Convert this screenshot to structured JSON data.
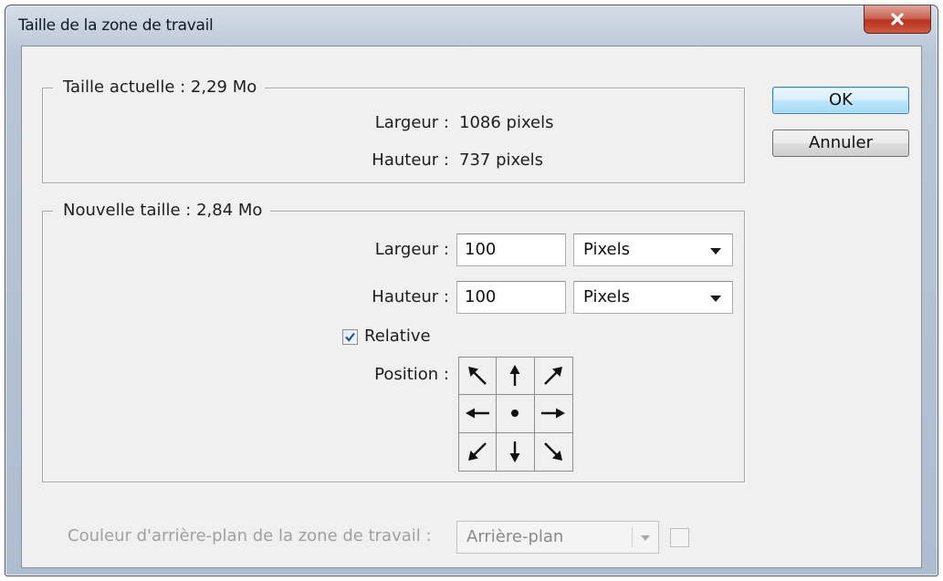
{
  "window": {
    "title": "Taille de la zone de travail"
  },
  "current_size": {
    "legend": "Taille actuelle : 2,29 Mo",
    "width_label": "Largeur :",
    "width_value": "1086 pixels",
    "height_label": "Hauteur :",
    "height_value": "737 pixels"
  },
  "new_size": {
    "legend": "Nouvelle taille : 2,84 Mo",
    "width_label": "Largeur :",
    "width_value": "100",
    "width_unit": "Pixels",
    "height_label": "Hauteur :",
    "height_value": "100",
    "height_unit": "Pixels",
    "relative_label": "Relative",
    "relative_checked": true,
    "position_label": "Position :",
    "anchor_grid": [
      [
        "arrow-up-left-icon",
        "arrow-up-icon",
        "arrow-up-right-icon"
      ],
      [
        "arrow-left-icon",
        "center-dot-icon",
        "arrow-right-icon"
      ],
      [
        "arrow-down-left-icon",
        "arrow-down-icon",
        "arrow-down-right-icon"
      ]
    ]
  },
  "buttons": {
    "ok": "OK",
    "cancel": "Annuler"
  },
  "canvas_extension": {
    "label": "Couleur d'arrière-plan de la zone de travail :",
    "value": "Arrière-plan",
    "enabled": false
  },
  "colors": {
    "close_button": "#c9513f",
    "ok_button_border": "#3c7fb1",
    "client_background": "#f0f0f0"
  }
}
